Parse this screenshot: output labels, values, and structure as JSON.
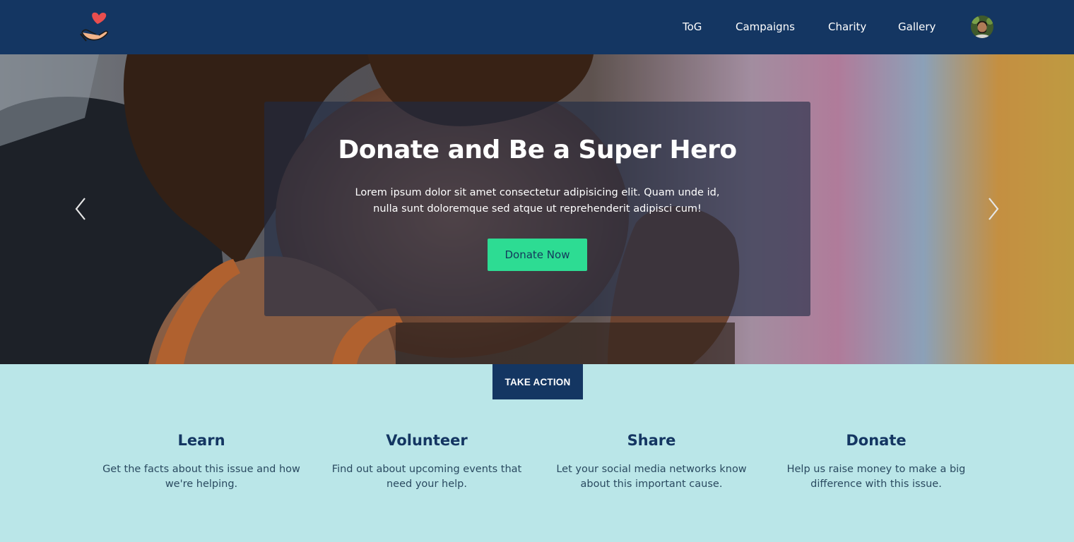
{
  "nav": {
    "logo_icon": "hand-heart-icon",
    "links": [
      "ToG",
      "Campaigns",
      "Charity",
      "Gallery"
    ],
    "avatar_icon": "user-avatar"
  },
  "hero": {
    "title": "Donate and Be a Super Hero",
    "text": "Lorem ipsum dolor sit amet consectetur adipisicing elit. Quam unde id, nulla sunt doloremque sed atque ut reprehenderit adipisci cum!",
    "button_label": "Donate Now",
    "prev_icon": "chevron-left-icon",
    "next_icon": "chevron-right-icon"
  },
  "take_action": {
    "label": "TAKE ACTION"
  },
  "features": [
    {
      "title": "Learn",
      "text": "Get the facts about this issue and how we're helping."
    },
    {
      "title": "Volunteer",
      "text": "Find out about upcoming events that need your help."
    },
    {
      "title": "Share",
      "text": "Let your social media networks know about this important cause."
    },
    {
      "title": "Donate",
      "text": "Help us raise money to make a big difference with this issue."
    }
  ],
  "colors": {
    "navbar": "#143662",
    "accent_button": "#2ddc93",
    "section_bg": "#bae6e8",
    "heading": "#143662"
  }
}
